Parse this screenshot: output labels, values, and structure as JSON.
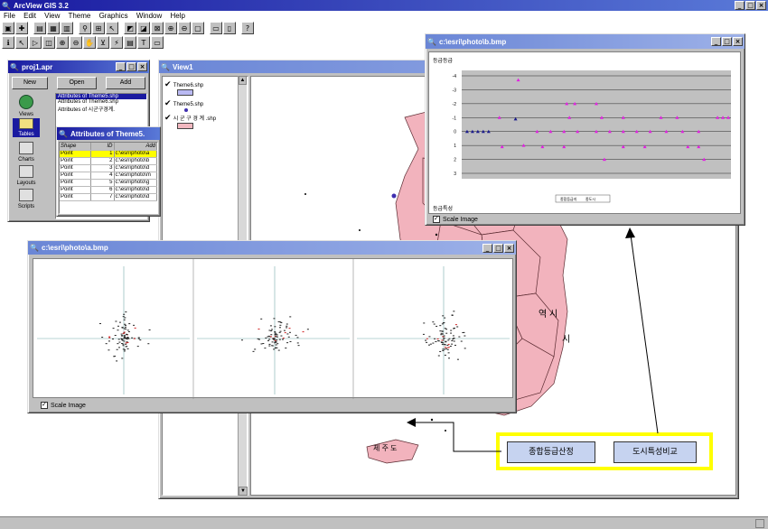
{
  "app": {
    "title": "ArcView GIS 3.2"
  },
  "menu": [
    "File",
    "Edit",
    "View",
    "Theme",
    "Graphics",
    "Window",
    "Help"
  ],
  "project_window": {
    "title": "proj1.apr",
    "buttons": {
      "new": "New",
      "open": "Open",
      "add": "Add"
    },
    "categories": [
      "Views",
      "Tables",
      "Charts",
      "Layouts",
      "Scripts"
    ],
    "list": [
      "Attributes of Theme5.shp",
      "Attributes of Theme6.shp",
      "Attributes of 시군구경계."
    ]
  },
  "attr_table": {
    "title": "Attributes of Theme5.",
    "headers": [
      "Shape",
      "ID",
      "Add"
    ],
    "rows": [
      [
        "Point",
        "1",
        "c:\\esri\\photo\\a"
      ],
      [
        "Point",
        "2",
        "c:\\esri\\photo\\b"
      ],
      [
        "Point",
        "3",
        "c:\\esri\\photo\\d"
      ],
      [
        "Point",
        "4",
        "c:\\esri\\photo\\m"
      ],
      [
        "Point",
        "5",
        "c:\\esri\\photo\\g"
      ],
      [
        "Point",
        "6",
        "c:\\esri\\photo\\d"
      ],
      [
        "Point",
        "7",
        "c:\\esri\\photo\\d"
      ]
    ]
  },
  "view_window": {
    "title": "View1",
    "themes": [
      {
        "name": "Theme6.shp",
        "swatch": "#b9b9f2"
      },
      {
        "name": "Theme5.shp",
        "swatch": "#3f2fb0"
      },
      {
        "name": "시 군 구 경 계 .shp",
        "swatch": "#f2b8c0"
      }
    ],
    "map_labels": [
      "역 시",
      "시",
      "제 주 도"
    ]
  },
  "photo_window_b": {
    "title": "c:\\esri\\photo\\b.bmp",
    "y_axis_title": "등급등급",
    "x_axis_title": "등급특성",
    "y_ticks": [
      "-4",
      "-3",
      "-2",
      "-1",
      "0",
      "1",
      "2",
      "3"
    ],
    "legend": [
      "종합등급지",
      "종도시"
    ],
    "scale_label": "Scale Image",
    "colors": {
      "series1": "#1a1a8c",
      "series2": "#e020e0"
    }
  },
  "photo_window_a": {
    "title": "c:\\esri\\photo\\a.bmp",
    "scale_label": "Scale Image"
  },
  "callouts": {
    "left_button": "종합등급산정",
    "right_button": "도시특성비교"
  },
  "colors": {
    "map_fill": "#f2b3bd",
    "highlight": "#ffff00",
    "title_active": "#1a1aa0"
  }
}
